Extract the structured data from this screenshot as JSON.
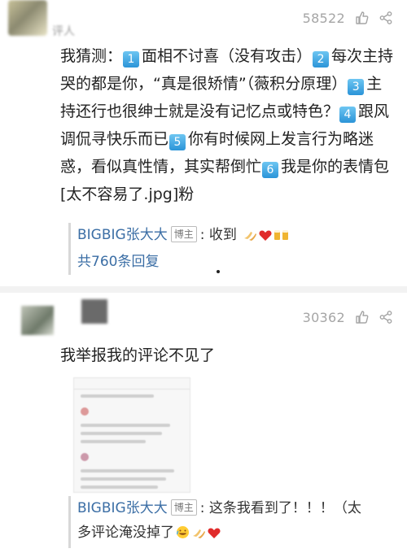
{
  "comments": [
    {
      "username": "评人",
      "like_count": "58522",
      "body": [
        {
          "t": "我猜测："
        },
        {
          "n": "1"
        },
        {
          "t": "面相不讨喜（没有攻击）"
        },
        {
          "n": "2"
        },
        {
          "t": "每次主持哭的都是你，“真是很矫情”（薇积分原理）"
        },
        {
          "n": "3"
        },
        {
          "t": "主持还行也很绅士就是没有记忆点或特色？"
        },
        {
          "n": "4"
        },
        {
          "t": "跟风调侃寻快乐而已"
        },
        {
          "n": "5"
        },
        {
          "t": "你有时候网上发言行为略迷惑，看似真性情，其实帮倒忙"
        },
        {
          "n": "6"
        },
        {
          "t": "我是你的表情包[太不容易了.jpg]粉"
        }
      ],
      "reply": {
        "name": "BIGBIG张大大",
        "badge": "博主",
        "text": ": 收到"
      },
      "more_replies": "共760条回复"
    },
    {
      "like_count": "30362",
      "body": "我举报我的评论不见了",
      "reply": {
        "name": "BIGBIG张大大",
        "badge": "博主",
        "text_1": ": 这条我看到了！！！（太",
        "text_2": "多评论淹没掉了"
      }
    }
  ],
  "icons": [
    "thumbs-up-icon",
    "share-icon"
  ]
}
